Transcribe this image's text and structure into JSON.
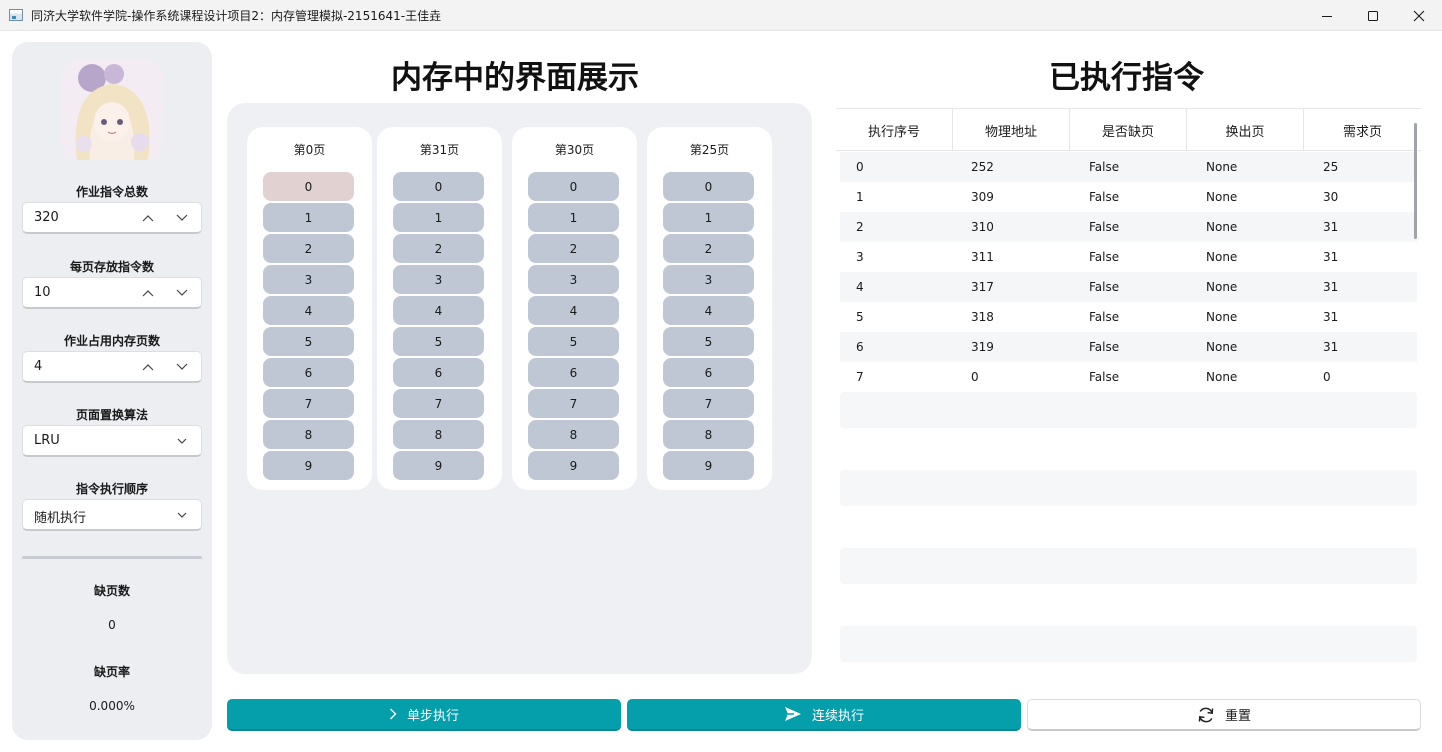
{
  "window": {
    "title": "同济大学软件学院-操作系统课程设计项目2：内存管理模拟-2151641-王佳垚"
  },
  "sidebar": {
    "avatar_icon": "anime-avatar-icon",
    "total_instructions": {
      "label": "作业指令总数",
      "value": "320"
    },
    "per_page": {
      "label": "每页存放指令数",
      "value": "10"
    },
    "mem_pages": {
      "label": "作业占用内存页数",
      "value": "4"
    },
    "algorithm": {
      "label": "页面置换算法",
      "value": "LRU"
    },
    "order": {
      "label": "指令执行顺序",
      "value": "随机执行"
    },
    "fault_count": {
      "label": "缺页数",
      "value": "0"
    },
    "fault_rate": {
      "label": "缺页率",
      "value": "0.000%"
    }
  },
  "memory": {
    "title": "内存中的界面展示",
    "pages": [
      {
        "title": "第0页",
        "slots": [
          "0",
          "1",
          "2",
          "3",
          "4",
          "5",
          "6",
          "7",
          "8",
          "9"
        ],
        "highlight": 0
      },
      {
        "title": "第31页",
        "slots": [
          "0",
          "1",
          "2",
          "3",
          "4",
          "5",
          "6",
          "7",
          "8",
          "9"
        ],
        "highlight": -1
      },
      {
        "title": "第30页",
        "slots": [
          "0",
          "1",
          "2",
          "3",
          "4",
          "5",
          "6",
          "7",
          "8",
          "9"
        ],
        "highlight": -1
      },
      {
        "title": "第25页",
        "slots": [
          "0",
          "1",
          "2",
          "3",
          "4",
          "5",
          "6",
          "7",
          "8",
          "9"
        ],
        "highlight": -1
      }
    ],
    "colors": {
      "slot": "#bec7d3",
      "slot_highlight": "#e2d1d1"
    }
  },
  "executed": {
    "title": "已执行指令",
    "columns": [
      "执行序号",
      "物理地址",
      "是否缺页",
      "换出页",
      "需求页"
    ],
    "rows": [
      [
        "0",
        "252",
        "False",
        "None",
        "25"
      ],
      [
        "1",
        "309",
        "False",
        "None",
        "30"
      ],
      [
        "2",
        "310",
        "False",
        "None",
        "31"
      ],
      [
        "3",
        "311",
        "False",
        "None",
        "31"
      ],
      [
        "4",
        "317",
        "False",
        "None",
        "31"
      ],
      [
        "5",
        "318",
        "False",
        "None",
        "31"
      ],
      [
        "6",
        "319",
        "False",
        "None",
        "31"
      ],
      [
        "7",
        "0",
        "False",
        "None",
        "0"
      ]
    ]
  },
  "buttons": {
    "step": {
      "label": "单步执行",
      "icon": "chevron-right-icon"
    },
    "continuous": {
      "label": "连续执行",
      "icon": "send-icon"
    },
    "reset": {
      "label": "重置",
      "icon": "refresh-icon"
    }
  },
  "colors": {
    "accent": "#049fab",
    "sidebar_bg": "#eceef2",
    "panel_bg": "#eff0f4"
  }
}
